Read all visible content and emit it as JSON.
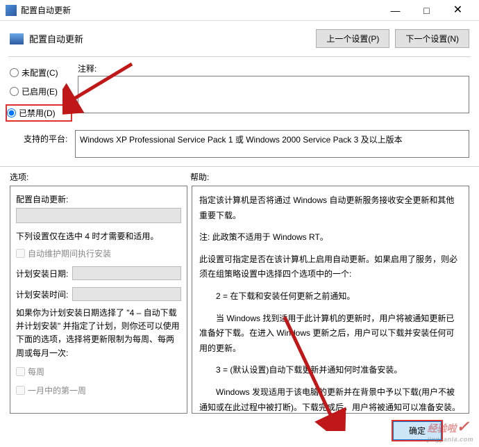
{
  "window": {
    "title": "配置自动更新",
    "minimize": "—",
    "maximize": "□",
    "close": "✕"
  },
  "header": {
    "title": "配置自动更新",
    "prev_btn": "上一个设置(P)",
    "next_btn": "下一个设置(N)"
  },
  "radios": {
    "not_configured": "未配置(C)",
    "enabled": "已启用(E)",
    "disabled": "已禁用(D)"
  },
  "comment": {
    "label": "注释:",
    "value": ""
  },
  "platform": {
    "label": "支持的平台:",
    "text": "Windows XP Professional Service Pack 1 或 Windows 2000 Service Pack 3 及以上版本"
  },
  "panels": {
    "options_label": "选项:",
    "help_label": "帮助:"
  },
  "options": {
    "config_label": "配置自动更新:",
    "info": "下列设置仅在选中 4 时才需要和适用。",
    "chk_maint": "自动维护期间执行安装",
    "plan_date": "计划安装日期:",
    "plan_time": "计划安装时间:",
    "para": "如果你为计划安装日期选择了 \"4 – 自动下载并计划安装\" 并指定了计划，则你还可以使用下面的选项，选择将更新限制为每周、每两周或每月一次:",
    "chk_weekly": "每周",
    "chk_month1": "一月中的第一周"
  },
  "help": {
    "p1": "指定该计算机是否将通过 Windows 自动更新服务接收安全更新和其他重要下载。",
    "p2": "注: 此政策不适用于 Windows RT。",
    "p3": "此设置可指定是否在该计算机上启用自动更新。如果启用了服务，则必须在组策略设置中选择四个选项中的一个:",
    "p4": "2 = 在下载和安装任何更新之前通知。",
    "p5": "当 Windows 找到适用于此计算机的更新时，用户将被通知更新已准备好下载。在进入 Windows 更新之后，用户可以下载并安装任何可用的更新。",
    "p6": "3 = (默认设置)自动下载更新并通知何时准备安装。",
    "p7": "Windows 发现适用于该电脑的更新并在背景中予以下载(用户不被通知或在此过程中被打断)。下载完成后，用户将被通知可以准备安装。在 Windows 更新后，用户可以进行安装。"
  },
  "footer": {
    "ok": "确定"
  },
  "watermark": "经验啦"
}
